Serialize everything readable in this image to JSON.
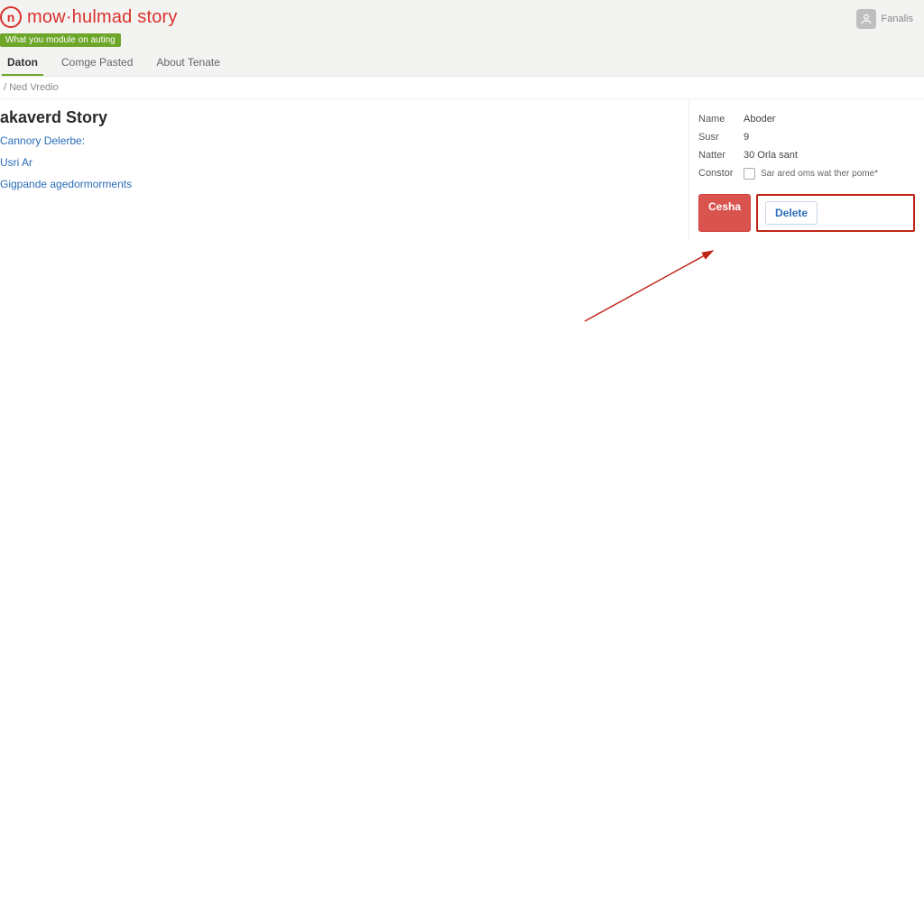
{
  "brand": {
    "logo_glyph": "n",
    "text": "mow·hulmad story"
  },
  "notice": "What you module on auting",
  "tabs": [
    {
      "label": "Daton",
      "active": true
    },
    {
      "label": "Comge Pasted",
      "active": false
    },
    {
      "label": "About Tenate",
      "active": false
    }
  ],
  "breadcrumb": "/ Ned Vredio",
  "header_user": "Fanalis",
  "page": {
    "title": "akaverd Story",
    "links": [
      "Cannory Delerbe:",
      "Usri Ar",
      "Gigpande agedormorments"
    ]
  },
  "panel": {
    "fields": [
      {
        "label": "Name",
        "value": "Aboder"
      },
      {
        "label": "Susr",
        "value": "9"
      },
      {
        "label": "Natter",
        "value": "30 Orla sant"
      }
    ],
    "checkbox": {
      "label": "Constor",
      "text": "Sar ared oms wat ther pome*"
    },
    "actions": {
      "primary": "Cesha",
      "delete": "Delete"
    }
  }
}
